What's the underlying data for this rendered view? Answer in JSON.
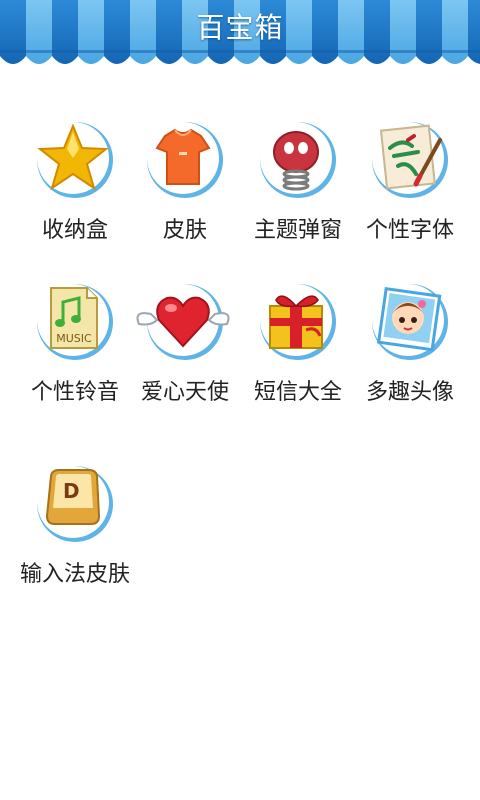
{
  "header": {
    "title": "百宝箱"
  },
  "colors": {
    "header_dark": "#1c78c8",
    "header_light": "#5fb6ec",
    "background": "#ffffff"
  },
  "apps": [
    {
      "label": "收纳盒",
      "icon": "star-icon"
    },
    {
      "label": "皮肤",
      "icon": "tshirt-icon"
    },
    {
      "label": "主题弹窗",
      "icon": "spring-button-icon"
    },
    {
      "label": "个性字体",
      "icon": "calligraphy-brush-icon"
    },
    {
      "label": "个性铃音",
      "icon": "music-file-icon"
    },
    {
      "label": "爱心天使",
      "icon": "winged-heart-icon"
    },
    {
      "label": "短信大全",
      "icon": "gift-box-icon"
    },
    {
      "label": "多趣头像",
      "icon": "avatar-photo-icon"
    },
    {
      "label": "输入法皮肤",
      "icon": "keyboard-key-icon"
    }
  ],
  "icon_texts": {
    "music": "MUSIC",
    "key": "D"
  }
}
